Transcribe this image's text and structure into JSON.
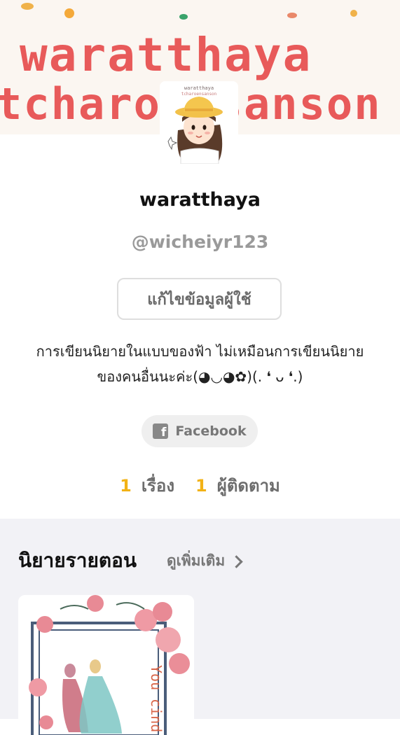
{
  "banner": {
    "line1": "waratthaya",
    "line2": "tcharoensanson"
  },
  "avatar": {
    "caption_line1": "waratthaya",
    "caption_line2": "tcharoensanson"
  },
  "profile": {
    "display_name": "waratthaya",
    "handle": "@wicheiyr123",
    "edit_button": "แก้ไขข้อมูลผู้ใช้",
    "bio_line1": "การเขียนนิยายในแบบของฟ้า ไม่เหมือนการเขียนนิยาย",
    "bio_line2": "ของคนอื่นนะค่ะ(◕◡◕✿)(. ❛ ᴗ ❛.)",
    "facebook_label": "Facebook"
  },
  "stats": [
    {
      "value": "1",
      "label": "เรื่อง"
    },
    {
      "value": "1",
      "label": "ผู้ติดตาม"
    }
  ],
  "section": {
    "title": "นิยายรายตอน",
    "more_label": "ดูเพิ่มเติม"
  },
  "card": {
    "cover_text": "You cind"
  },
  "colors": {
    "banner_text": "#e85a5a",
    "accent": "#f2b216",
    "section_bg": "#f2f2f6"
  }
}
